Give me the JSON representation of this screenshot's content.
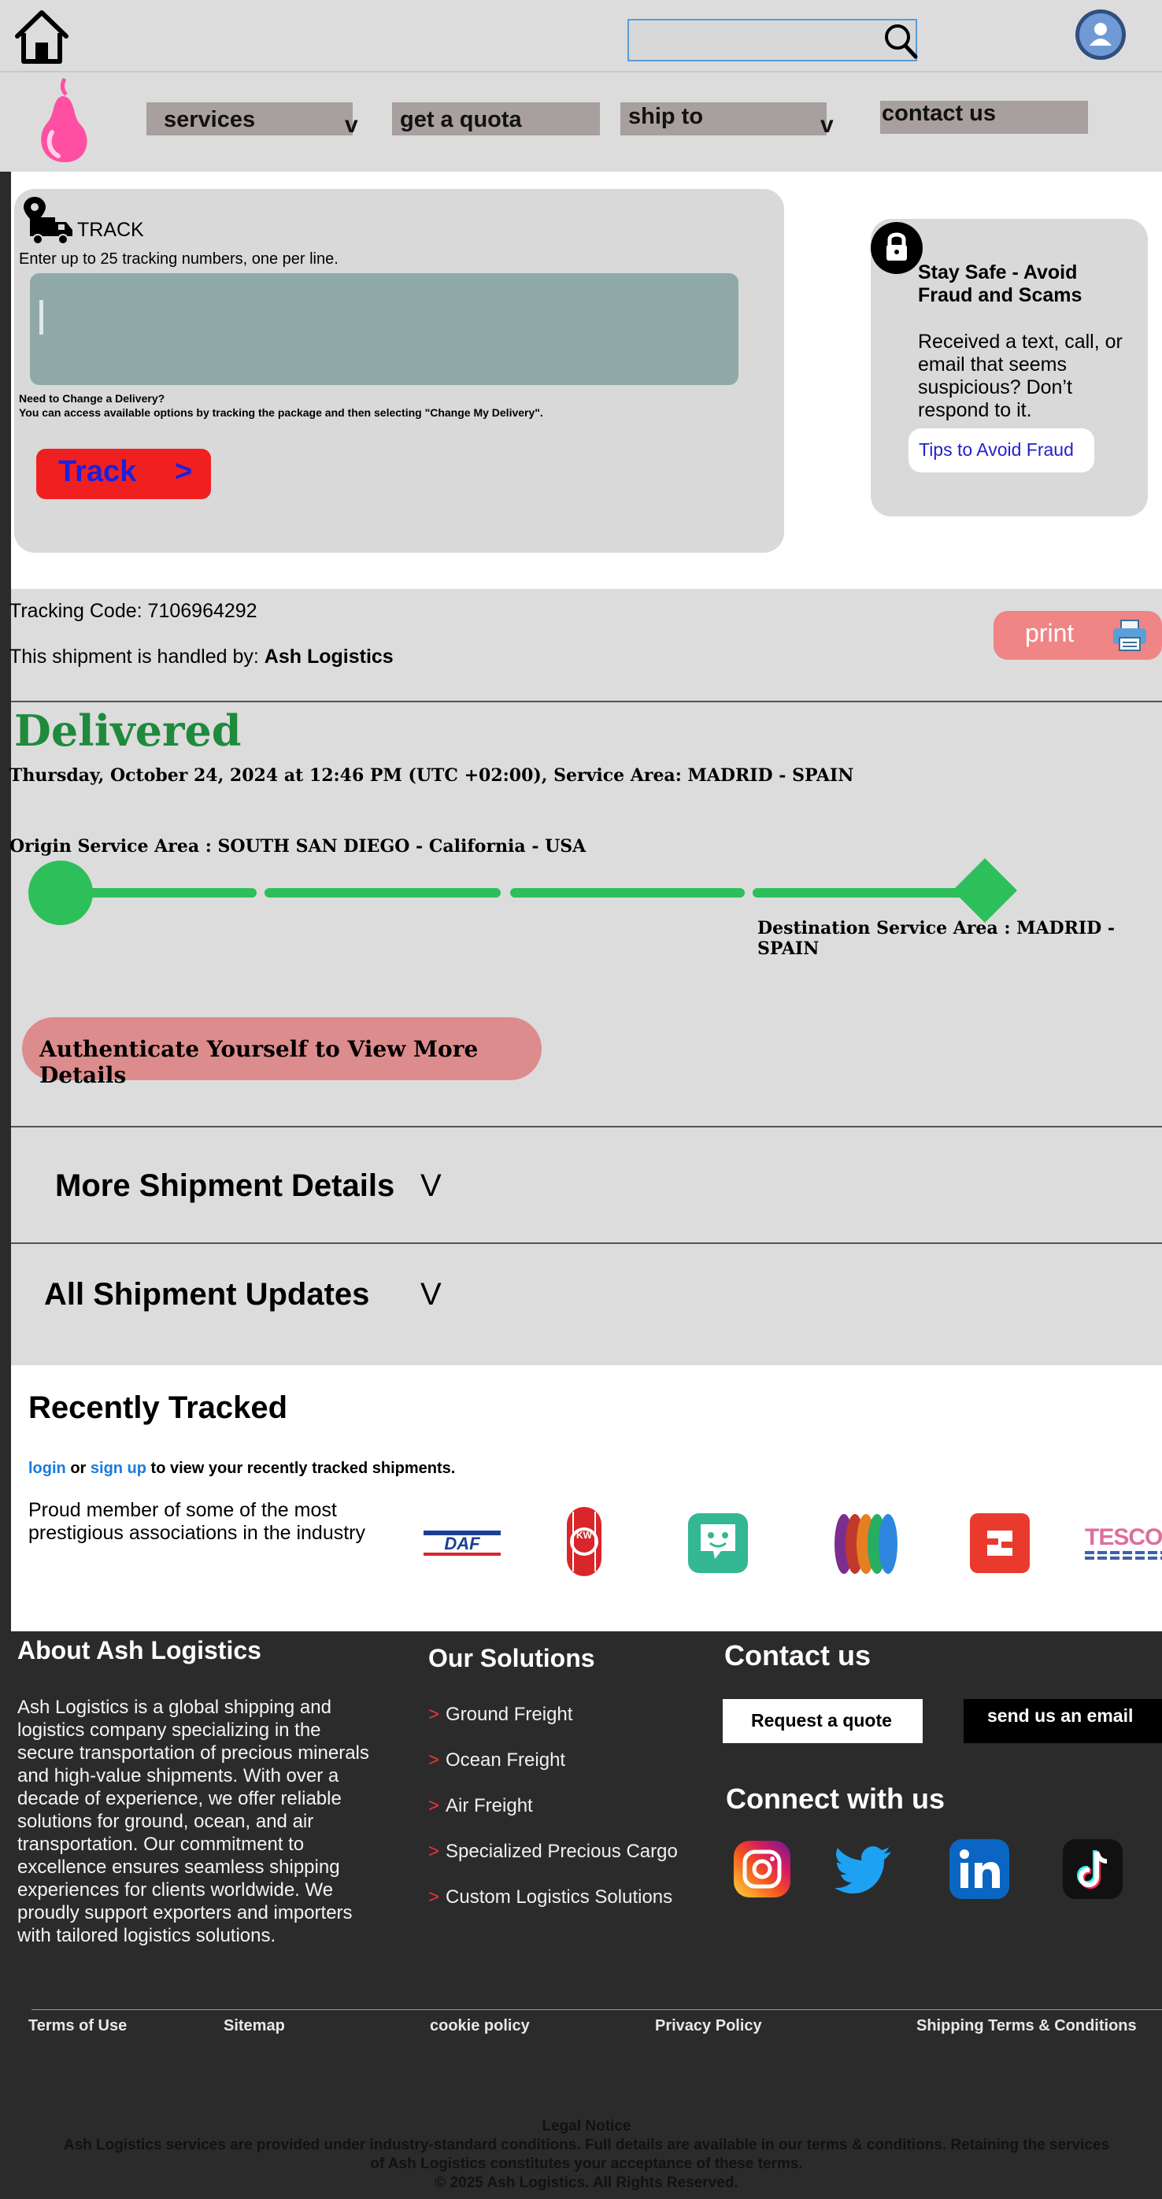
{
  "header": {
    "search": {
      "placeholder": ""
    }
  },
  "nav": {
    "services": "services",
    "get_quota": "get a quota",
    "ship_to": "ship to",
    "contact_us": "contact us",
    "dropdown_glyph": "v"
  },
  "track": {
    "title": "TRACK",
    "instructions": "Enter up to 25 tracking numbers, one per line.",
    "change_q": "Need to Change a Delivery?",
    "change_help": "You can access available options by tracking the package and then selecting \"Change My Delivery\".",
    "button_label": "Track",
    "button_arrow": ">"
  },
  "safety": {
    "title": "Stay Safe - Avoid Fraud and Scams",
    "body": "Received a text, call, or email that seems suspicious? Don’t respond to it.",
    "link": "Tips to Avoid Fraud"
  },
  "shipment": {
    "code_label": "Tracking Code: ",
    "code": "7106964292",
    "handled_label": "This shipment is handled by: ",
    "handler": "Ash Logistics",
    "print": "print",
    "status": "Delivered",
    "status_detail": "Thursday, October 24, 2024 at 12:46 PM (UTC +02:00), Service Area: MADRID - SPAIN",
    "origin": "Origin Service Area : SOUTH SAN DIEGO - California - USA",
    "destination": "Destination Service Area : MADRID - SPAIN",
    "progress": 1.0,
    "auth_button": "Authenticate Yourself to View More Details",
    "more_details": "More Shipment Details",
    "all_updates": "All Shipment Updates",
    "expand_glyph": "V"
  },
  "recent": {
    "title": "Recently Tracked",
    "login": "login",
    "or": " or ",
    "signup": "sign up",
    "rest": " to view your recently tracked shipments.",
    "member_text": "Proud member of some of the most prestigious associations in the industry",
    "logos": {
      "daf": "DAF",
      "kw": "KW",
      "tesco": "TESCO"
    }
  },
  "footer": {
    "about_title": "About Ash Logistics",
    "about_body": "Ash Logistics is a global shipping and logistics company specializing in the secure transportation of precious minerals and high-value shipments. With over a decade of experience, we offer reliable solutions for ground, ocean, and air transportation. Our commitment to excellence ensures seamless shipping experiences for clients worldwide. We proudly support exporters and importers with tailored logistics solutions.",
    "solutions_title": "Our Solutions",
    "solutions": [
      "Ground Freight",
      "Ocean Freight",
      "Air Freight",
      "Specialized Precious Cargo",
      "Custom Logistics Solutions"
    ],
    "solutions_arrow": ">",
    "contact_title": "Contact us",
    "request_quote": "Request a quote",
    "send_email": "send us an email",
    "connect_title": "Connect with us",
    "links": {
      "terms": "Terms of Use",
      "sitemap": "Sitemap",
      "cookie": "cookie policy",
      "privacy": "Privacy Policy",
      "shipping_terms": "Shipping Terms & Conditions"
    },
    "legal_title": "Legal Notice",
    "legal_text_1": "Ash Logistics services are provided under industry-standard conditions. Full details are available in our terms & conditions. Retaining the services",
    "legal_text_2": "of Ash Logistics constitutes your acceptance of these terms.",
    "copyright": "© 2025 Ash Logistics. All Rights Reserved."
  },
  "colors": {
    "nav_bg": "#dcdcdc",
    "nav_button": "#a89f9f",
    "track_button": "#f02020",
    "status_green": "#1f8a3c",
    "progress_green": "#2dbf5a",
    "print_button": "#ef8585",
    "auth_button": "#dc8c8c",
    "footer_bg": "#2b2b2b",
    "link_blue": "#1a7ae0"
  },
  "icons": [
    "home-icon",
    "search-icon",
    "user-avatar-icon",
    "pear-logo",
    "delivery-truck-icon",
    "lock-icon",
    "printer-icon",
    "instagram-icon",
    "twitter-icon",
    "linkedin-icon",
    "tiktok-icon"
  ]
}
